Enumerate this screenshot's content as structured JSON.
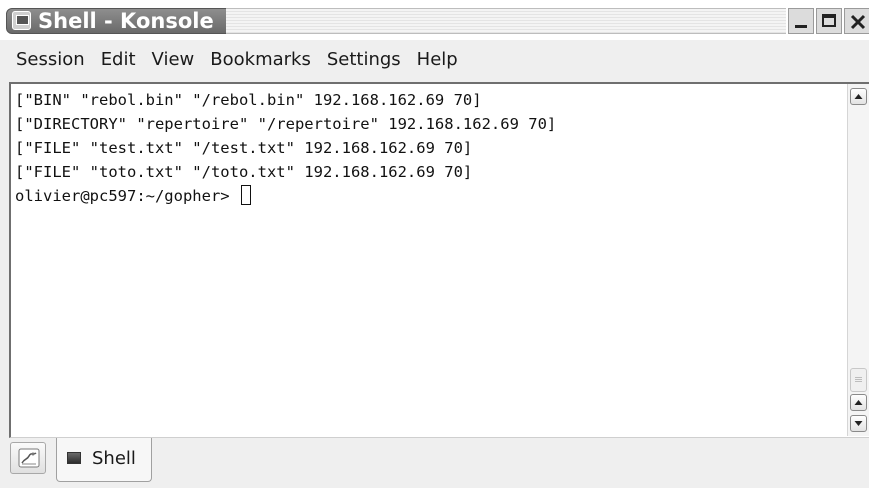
{
  "window": {
    "title": "Shell - Konsole",
    "icon": "konsole-app-icon"
  },
  "window_buttons": {
    "minimize_icon": "minimize-icon",
    "maximize_icon": "maximize-icon",
    "close_icon": "close-icon"
  },
  "menubar": {
    "items": [
      {
        "label": "Session"
      },
      {
        "label": "Edit"
      },
      {
        "label": "View"
      },
      {
        "label": "Bookmarks"
      },
      {
        "label": "Settings"
      },
      {
        "label": "Help"
      }
    ]
  },
  "terminal": {
    "lines": [
      "[\"BIN\" \"rebol.bin\" \"/rebol.bin\" 192.168.162.69 70]",
      "[\"DIRECTORY\" \"repertoire\" \"/repertoire\" 192.168.162.69 70]",
      "[\"FILE\" \"test.txt\" \"/test.txt\" 192.168.162.69 70]",
      "[\"FILE\" \"toto.txt\" \"/toto.txt\" 192.168.162.69 70]"
    ],
    "prompt": "olivier@pc597:~/gopher> "
  },
  "tabbar": {
    "new_session_icon": "new-session-icon",
    "tabs": [
      {
        "label": "Shell",
        "icon": "terminal-icon",
        "active": true
      }
    ]
  }
}
